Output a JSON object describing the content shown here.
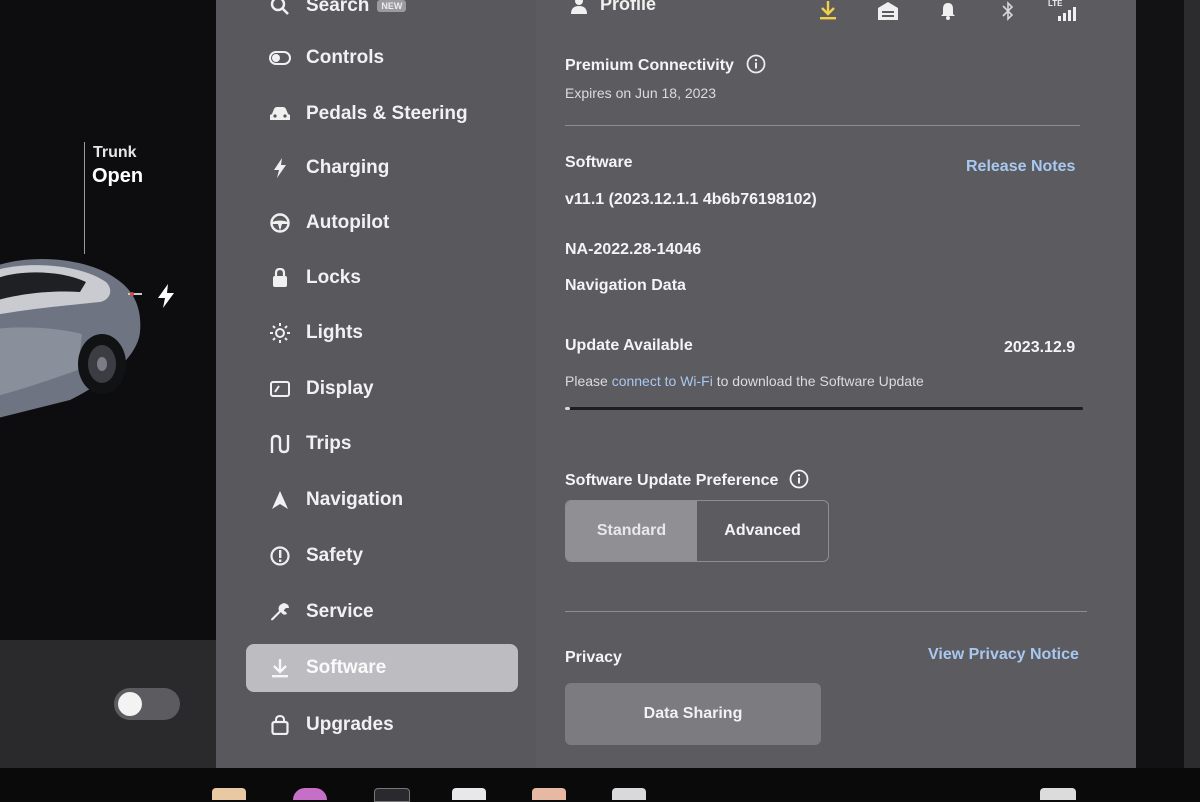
{
  "car": {
    "trunk_label": "Trunk",
    "trunk_state": "Open"
  },
  "sidebar": {
    "items": [
      {
        "label": "Search",
        "icon": "search-icon",
        "badge": "NEW"
      },
      {
        "label": "Controls",
        "icon": "toggle-icon"
      },
      {
        "label": "Pedals & Steering",
        "icon": "car-icon"
      },
      {
        "label": "Charging",
        "icon": "lightning-icon"
      },
      {
        "label": "Autopilot",
        "icon": "steering-wheel-icon"
      },
      {
        "label": "Locks",
        "icon": "lock-icon"
      },
      {
        "label": "Lights",
        "icon": "sun-icon"
      },
      {
        "label": "Display",
        "icon": "display-icon"
      },
      {
        "label": "Trips",
        "icon": "trips-icon"
      },
      {
        "label": "Navigation",
        "icon": "navigation-arrow-icon"
      },
      {
        "label": "Safety",
        "icon": "alert-circle-icon"
      },
      {
        "label": "Service",
        "icon": "wrench-icon"
      },
      {
        "label": "Software",
        "icon": "download-icon",
        "active": true
      },
      {
        "label": "Upgrades",
        "icon": "shopping-bag-icon"
      }
    ]
  },
  "status": {
    "profile_label": "Profile",
    "signal_label": "LTE",
    "download_color": "#f2d046"
  },
  "content": {
    "premium": {
      "title": "Premium Connectivity",
      "expires": "Expires on Jun 18, 2023"
    },
    "software": {
      "title": "Software",
      "release_notes": "Release Notes",
      "version": "v11.1 (2023.12.1.1 4b6b76198102)",
      "nav_data_version": "NA-2022.28-14046",
      "nav_data_label": "Navigation Data"
    },
    "update": {
      "title": "Update Available",
      "version": "2023.12.9",
      "msg_prefix": "Please",
      "msg_link": "connect to Wi-Fi",
      "msg_suffix": "to download the Software Update",
      "progress": 0.01
    },
    "preference": {
      "title": "Software Update Preference",
      "options": [
        "Standard",
        "Advanced"
      ],
      "selected": "Standard"
    },
    "privacy": {
      "title": "Privacy",
      "notice_link": "View Privacy Notice",
      "data_sharing": "Data Sharing"
    }
  },
  "colors": {
    "sidebar_bg": "#58585d",
    "content_bg": "#5b5b60",
    "link": "#a9c8f0",
    "active_item_bg": "#bdbdc1"
  }
}
